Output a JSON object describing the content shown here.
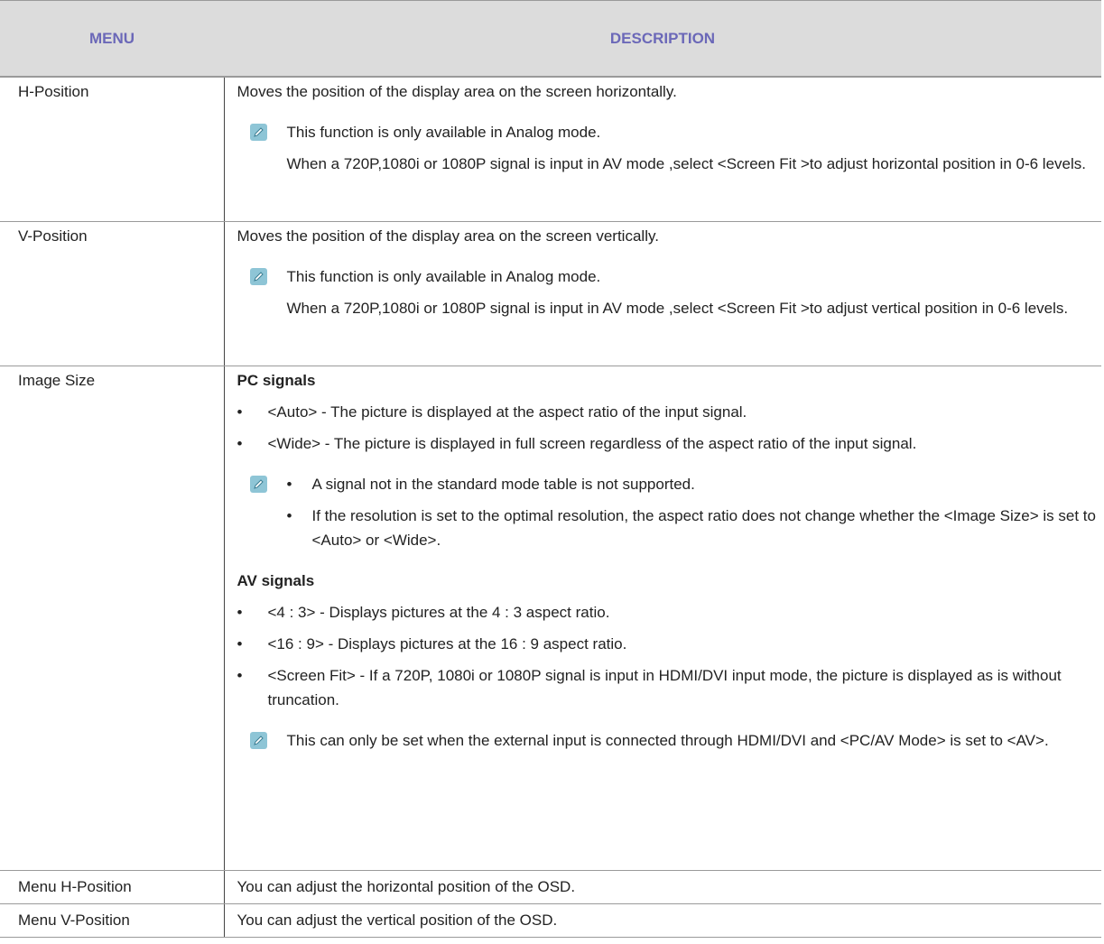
{
  "header": {
    "menu": "MENU",
    "description": "DESCRIPTION"
  },
  "rows": [
    {
      "menu": "H-Position",
      "text": "Moves the position of the display area on the screen horizontally.",
      "note1": "This function is only available in Analog mode.",
      "note2": "When a 720P,1080i or 1080P signal is input in AV mode ,select <Screen Fit  >to adjust horizontal position in 0-6 levels."
    },
    {
      "menu": "V-Position",
      "text": "Moves the position of the display area on the screen vertically.",
      "note1": "This function is only available in Analog mode.",
      "note2": "When a 720P,1080i or 1080P signal is input in AV mode ,select <Screen Fit  >to adjust vertical position in 0-6 levels."
    },
    {
      "menu": "Image Size",
      "pc_heading": "PC signals",
      "pc_items": [
        "<Auto> - The picture is displayed at the aspect ratio of the input signal.",
        "<Wide> - The picture is displayed in full screen regardless of the aspect ratio of the input signal."
      ],
      "pc_notes": [
        "A signal not in the standard mode table is not supported.",
        "If the resolution is set to the optimal resolution, the aspect ratio does not change whether the <Image Size> is set to <Auto> or <Wide>."
      ],
      "av_heading": "AV signals",
      "av_items": [
        "<4 : 3> - Displays pictures at the 4 : 3 aspect ratio.",
        "<16 : 9> - Displays pictures at the 16 : 9 aspect ratio.",
        "<Screen Fit> - If a 720P, 1080i or 1080P signal is input in HDMI/DVI input mode, the picture is displayed as is without truncation."
      ],
      "av_note": "This can only be set when the external input is connected through HDMI/DVI and <PC/AV Mode> is set to <AV>."
    },
    {
      "menu": "Menu H-Position",
      "text": "You can adjust the horizontal position of the OSD."
    },
    {
      "menu": "Menu V-Position",
      "text": "You can adjust the vertical position of the OSD."
    }
  ]
}
